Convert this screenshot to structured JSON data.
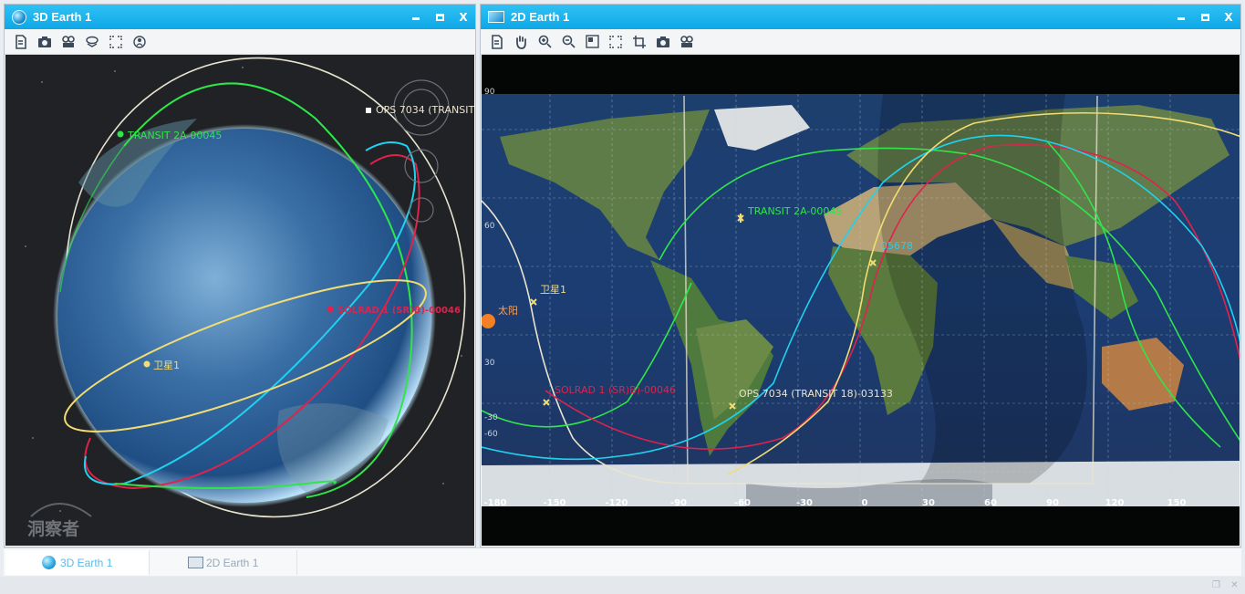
{
  "panes": {
    "earth3d": {
      "title": "3D Earth 1"
    },
    "earth2d": {
      "title": "2D Earth 1"
    }
  },
  "window_buttons": {
    "close": "X"
  },
  "view3d": {
    "labels": {
      "transit": "TRANSIT 2A-00045",
      "ops": "OPS 7034 (TRANSIT",
      "solrad": "SOLRAD 1 (SR)B)-00046",
      "weixing": "卫星1"
    },
    "watermark": "洞察者"
  },
  "view2d": {
    "labels": {
      "transit": "TRANSIT 2A-00045",
      "sat05678": "05678",
      "weixing": "卫星1",
      "sun": "太阳",
      "solrad": "SOLRAD 1 (SR)B)-00046",
      "ops": "OPS 7034 (TRANSIT 18)-03133"
    },
    "lon_ticks": [
      "-180",
      "-150",
      "-120",
      "-90",
      "-60",
      "-30",
      "0",
      "30",
      "60",
      "90",
      "120",
      "150"
    ],
    "lat_ticks": [
      "90",
      "60",
      "30",
      "-30",
      "-60"
    ]
  },
  "tabs": [
    {
      "label": "3D Earth 1",
      "active": true
    },
    {
      "label": "2D Earth 1",
      "active": false
    }
  ],
  "colors": {
    "titlebar": "#12aceb",
    "orbit_green": "#2ee64a",
    "orbit_red": "#e0224d",
    "orbit_cyan": "#1fd2ee",
    "orbit_yellow": "#f2dc74",
    "orbit_white": "#e9e4cf"
  }
}
